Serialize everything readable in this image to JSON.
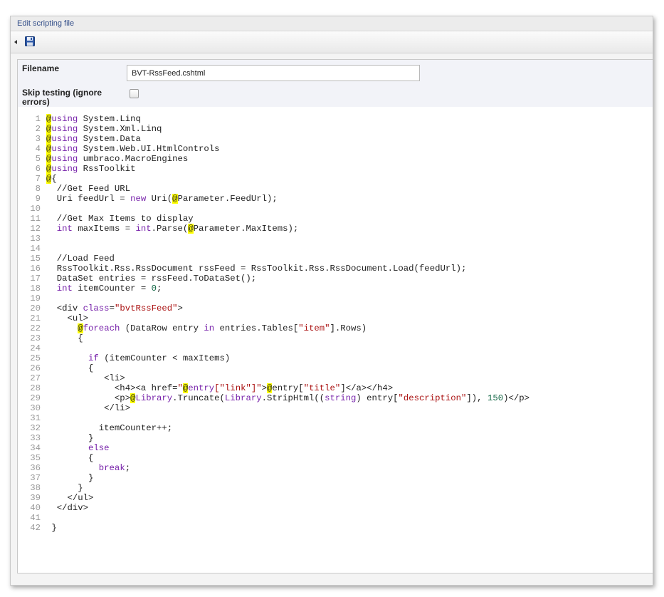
{
  "panel": {
    "title": "Edit scripting file"
  },
  "toolbar": {
    "back_icon": "triangle-left-icon",
    "save_icon": "floppy-disk-icon"
  },
  "form": {
    "filename_label": "Filename",
    "filename_value": "BVT-RssFeed.cshtml",
    "skip_label": "Skip testing (ignore errors)",
    "skip_checked": false
  },
  "colors": {
    "keyword": "#7722aa",
    "string": "#aa1111",
    "number": "#116644",
    "razor_highlight": "#ffff00",
    "link": "#35508a"
  },
  "code_lines": [
    [
      [
        "at",
        "@"
      ],
      [
        "kw",
        "using"
      ],
      [
        "t",
        " System.Linq"
      ]
    ],
    [
      [
        "at",
        "@"
      ],
      [
        "kw",
        "using"
      ],
      [
        "t",
        " System.Xml.Linq"
      ]
    ],
    [
      [
        "at",
        "@"
      ],
      [
        "kw",
        "using"
      ],
      [
        "t",
        " System.Data"
      ]
    ],
    [
      [
        "at",
        "@"
      ],
      [
        "kw",
        "using"
      ],
      [
        "t",
        " System.Web.UI.HtmlControls"
      ]
    ],
    [
      [
        "at",
        "@"
      ],
      [
        "kw",
        "using"
      ],
      [
        "t",
        " umbraco.MacroEngines"
      ]
    ],
    [
      [
        "at",
        "@"
      ],
      [
        "kw",
        "using"
      ],
      [
        "t",
        " RssToolkit"
      ]
    ],
    [
      [
        "at",
        "@"
      ],
      [
        "t",
        "{"
      ]
    ],
    [
      [
        "t",
        "  //Get Feed URL"
      ]
    ],
    [
      [
        "t",
        "  Uri feedUrl = "
      ],
      [
        "kw",
        "new"
      ],
      [
        "t",
        " Uri("
      ],
      [
        "at",
        "@"
      ],
      [
        "t",
        "Parameter.FeedUrl);"
      ]
    ],
    [],
    [
      [
        "t",
        "  //Get Max Items to display"
      ]
    ],
    [
      [
        "t",
        "  "
      ],
      [
        "kw",
        "int"
      ],
      [
        "t",
        " maxItems = "
      ],
      [
        "kw",
        "int"
      ],
      [
        "t",
        ".Parse("
      ],
      [
        "at",
        "@"
      ],
      [
        "t",
        "Parameter.MaxItems);"
      ]
    ],
    [],
    [],
    [
      [
        "t",
        "  //Load Feed"
      ]
    ],
    [
      [
        "t",
        "  RssToolkit.Rss.RssDocument rssFeed = RssToolkit.Rss.RssDocument.Load(feedUrl);"
      ]
    ],
    [
      [
        "t",
        "  DataSet entries = rssFeed.ToDataSet();"
      ]
    ],
    [
      [
        "t",
        "  "
      ],
      [
        "kw",
        "int"
      ],
      [
        "t",
        " itemCounter = "
      ],
      [
        "num",
        "0"
      ],
      [
        "t",
        ";"
      ]
    ],
    [],
    [
      [
        "t",
        "  <div "
      ],
      [
        "kw",
        "class"
      ],
      [
        "t",
        "="
      ],
      [
        "str",
        "\"bvtRssFeed\""
      ],
      [
        "t",
        ">"
      ]
    ],
    [
      [
        "t",
        "    <ul>"
      ]
    ],
    [
      [
        "t",
        "      "
      ],
      [
        "at",
        "@"
      ],
      [
        "kw",
        "foreach"
      ],
      [
        "t",
        " (DataRow entry "
      ],
      [
        "kw",
        "in"
      ],
      [
        "t",
        " entries.Tables["
      ],
      [
        "str",
        "\"item\""
      ],
      [
        "t",
        "].Rows)"
      ]
    ],
    [
      [
        "t",
        "      {"
      ]
    ],
    [],
    [
      [
        "t",
        "        "
      ],
      [
        "kw",
        "if"
      ],
      [
        "t",
        " (itemCounter < maxItems)"
      ]
    ],
    [
      [
        "t",
        "        {"
      ]
    ],
    [
      [
        "t",
        "           <li>"
      ]
    ],
    [
      [
        "t",
        "             <h4><a href="
      ],
      [
        "str",
        "\""
      ],
      [
        "at",
        "@"
      ],
      [
        "kw",
        "entry"
      ],
      [
        "str",
        "[\"link\"]\""
      ],
      [
        "t",
        ">"
      ],
      [
        "at",
        "@"
      ],
      [
        "t",
        "entry["
      ],
      [
        "str",
        "\"title\""
      ],
      [
        "t",
        "]</a></h4>"
      ]
    ],
    [
      [
        "t",
        "             <p>"
      ],
      [
        "at",
        "@"
      ],
      [
        "kw",
        "Library"
      ],
      [
        "t",
        ".Truncate("
      ],
      [
        "kw",
        "Library"
      ],
      [
        "t",
        ".StripHtml(("
      ],
      [
        "kw",
        "string"
      ],
      [
        "t",
        ") entry["
      ],
      [
        "str",
        "\"description\""
      ],
      [
        "t",
        "]), "
      ],
      [
        "num",
        "150"
      ],
      [
        "t",
        ")</p>"
      ]
    ],
    [
      [
        "t",
        "           </li>"
      ]
    ],
    [],
    [
      [
        "t",
        "          itemCounter++;"
      ]
    ],
    [
      [
        "t",
        "        }"
      ]
    ],
    [
      [
        "t",
        "        "
      ],
      [
        "kw",
        "else"
      ]
    ],
    [
      [
        "t",
        "        {"
      ]
    ],
    [
      [
        "t",
        "          "
      ],
      [
        "kw",
        "break"
      ],
      [
        "t",
        ";"
      ]
    ],
    [
      [
        "t",
        "        }"
      ]
    ],
    [
      [
        "t",
        "      }"
      ]
    ],
    [
      [
        "t",
        "    </ul>"
      ]
    ],
    [
      [
        "t",
        "  </div>"
      ]
    ],
    [],
    [
      [
        "t",
        " }"
      ]
    ]
  ]
}
